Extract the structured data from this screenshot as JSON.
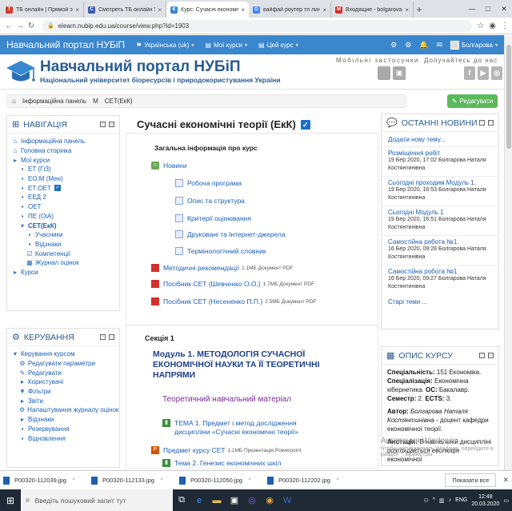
{
  "browser": {
    "tabs": [
      {
        "label": "ТБ онлайн | Прямой эфир",
        "color": "#d23b2b",
        "glyph": "Т"
      },
      {
        "label": "Смотреть ТБ онлайн Укра",
        "color": "#3b5bab",
        "glyph": "С"
      },
      {
        "label": "Курс: Сучасні економічні т",
        "color": "#3a87ce",
        "glyph": "К"
      },
      {
        "label": "вайфай роутер тп линк - Г",
        "color": "#4285f4",
        "glyph": "G"
      },
      {
        "label": "Входящие - bolgarova@gm",
        "color": "#d93025",
        "glyph": "M"
      }
    ],
    "url": "elearn.nubip.edu.ua/course/view.php?id=1903"
  },
  "moodle_nav": {
    "brand": "Навчальний портал НУБіП",
    "lang": "Українська (uk)",
    "my_courses": "Мої курси",
    "this_course": "Цей курс",
    "user": "Болгарова"
  },
  "banner": {
    "title": "Навчальний портал НУБіП",
    "subtitle": "Національний університет біоресурсів і природокористування України",
    "apps": "Мобільні застосунки",
    "join": "Долучайтесь до нас",
    "social": [
      "f",
      "▶",
      "◎"
    ]
  },
  "breadcrumb": [
    "Інформаційна панель",
    "М",
    "СЕТ(ЕкК)"
  ],
  "edit_button": "Редагувати",
  "navigation": {
    "title": "НАВІГАЦІЯ",
    "items": [
      {
        "label": "Інформаційна панель",
        "indent": 0,
        "icon": "⌂"
      },
      {
        "label": "Головна сторінка",
        "indent": 0,
        "icon": "⌂"
      },
      {
        "label": "Мої курси",
        "indent": 0,
        "icon": "▸"
      },
      {
        "label": "ЕТ (ГіЗ)",
        "indent": 1,
        "icon": "▪"
      },
      {
        "label": "ЕО:М (Мен)",
        "indent": 1,
        "icon": "▪"
      },
      {
        "label": "ЕТ:ОЕТ",
        "indent": 1,
        "icon": "▪",
        "check": true
      },
      {
        "label": "ЕЕД 2",
        "indent": 1,
        "icon": "▪"
      },
      {
        "label": "ОЕТ",
        "indent": 1,
        "icon": "▪"
      },
      {
        "label": "ПЕ (ОіА)",
        "indent": 1,
        "icon": "▪"
      },
      {
        "label": "СЕТ(ЕкК)",
        "indent": 1,
        "icon": "▾",
        "bold": true
      },
      {
        "label": "Учасники",
        "indent": 2,
        "icon": "▪"
      },
      {
        "label": "Відзнаки",
        "indent": 2,
        "icon": "▪"
      },
      {
        "label": "Компетенції",
        "indent": 2,
        "icon": "☑"
      },
      {
        "label": "Журнал оцінок",
        "indent": 2,
        "icon": "▦"
      },
      {
        "label": "Курси",
        "indent": 0,
        "icon": "▸"
      }
    ]
  },
  "management": {
    "title": "КЕРУВАННЯ",
    "items": [
      {
        "label": "Керування курсом",
        "indent": 0,
        "icon": "▾"
      },
      {
        "label": "Редагувати параметри",
        "indent": 1,
        "icon": "⚙"
      },
      {
        "label": "Редагувати",
        "indent": 1,
        "icon": "✎"
      },
      {
        "label": "Користувачі",
        "indent": 1,
        "icon": "▸"
      },
      {
        "label": "Фільтри",
        "indent": 1,
        "icon": "▼"
      },
      {
        "label": "Звіти",
        "indent": 1,
        "icon": "▸"
      },
      {
        "label": "Налаштування журналу оцінок",
        "indent": 1,
        "icon": "⚙"
      },
      {
        "label": "Відзнаки",
        "indent": 1,
        "icon": "▸"
      },
      {
        "label": "Резервування",
        "indent": 1,
        "icon": "▪"
      },
      {
        "label": "Відновлення",
        "indent": 1,
        "icon": "▪"
      }
    ]
  },
  "course": {
    "title": "Сучасні економічні теорії (ЕкК)",
    "general_heading": "Загальна інформація про курс",
    "general_activities": [
      {
        "label": "Новини",
        "type": "forum",
        "meta": ""
      },
      {
        "label": "Робоча програма",
        "type": "page",
        "meta": "",
        "indent": true
      },
      {
        "label": "Опис та структура",
        "type": "page",
        "meta": "",
        "indent": true
      },
      {
        "label": "Критерії оцінювання",
        "type": "page",
        "meta": "",
        "indent": true
      },
      {
        "label": "Друковані та Інтернет-джерела",
        "type": "page",
        "meta": "",
        "indent": true
      },
      {
        "label": "Термінологічний словник",
        "type": "page",
        "meta": "",
        "indent": true
      },
      {
        "label": "Методичні рекомендації",
        "type": "pdf",
        "meta": "1.1МБ Документ PDF"
      },
      {
        "label": "Посібник СЕТ (Шевченко О.О.)",
        "type": "pdf",
        "meta": "1.7МБ Документ PDF"
      },
      {
        "label": "Посібник СЕТ (Несененко П.П.)",
        "type": "pdf",
        "meta": "2.5МБ Документ PDF"
      }
    ],
    "section1": {
      "name": "Секція 1",
      "module_title": "Модуль 1.  МЕТОДОЛОГІЯ СУЧАСНОЇ ЕКОНОМІЧНОЇ НАУКИ ТА ЇЇ ТЕОРЕТИЧНІ НАПРЯМИ",
      "theory_label": "Теоретичний навчальний матеріал",
      "activities": [
        {
          "label": "ТЕМА 1. Предмет і метод дослідження дисципліни «Сучасні економічні теорії»",
          "type": "book",
          "meta": ""
        },
        {
          "label": "Предмет курсу СЕТ",
          "type": "ppt",
          "meta": "1.1МБ Презентація Powerpoint"
        },
        {
          "label": "Тема 2. Генезис економічних шкіл",
          "type": "book",
          "meta": ""
        }
      ]
    }
  },
  "news": {
    "title": "ОСТАННІ НОВИНИ",
    "add_link": "Додати нову тему...",
    "items": [
      {
        "title": "Розміщення робіт",
        "date": "19 Бер 2020, 17:02",
        "author": "Болгарова Наталя Костянтинівна"
      },
      {
        "title": "Сьогодні проходим Модуль 1.",
        "date": "19 Бер 2020, 16:53",
        "author": "Болгарова Наталя Костянтинівна"
      },
      {
        "title": "Сьогодні Модуль 1",
        "date": "19 Бер 2020, 16:51",
        "author": "Болгарова Наталя Костянтинівна"
      },
      {
        "title": "Самостійна робота №1.",
        "date": "16 Бер 2020, 09:28",
        "author": "Болгарова Наталя Костянтинівна"
      },
      {
        "title": "Самостійна робота №1",
        "date": "16 Бер 2020, 09:27",
        "author": "Болгарова Наталя Костянтинівна"
      }
    ],
    "older": "Старі теми ..."
  },
  "course_info": {
    "title": "ОПИС КУРСУ",
    "spec_label": "Спеціальність:",
    "spec_value": "151 Економіка.",
    "specialization_label": "Спеціалізація:",
    "specialization_value": "Економічна кібернетика.",
    "level_label": "ОС:",
    "level_value": "Бакалавр.",
    "semester_label": "Семестр:",
    "semester_value": "2.",
    "ects_label": "ECTS:",
    "ects_value": "3.",
    "author_label": "Автор:",
    "author_value": "Болгарова Наталя Костянтинівна",
    "author_rest": " - доцент кафедри економічної теорії.",
    "annot_label": "Анотація:",
    "annot_value": "В навчальній дисципліні розглядається еволюція економічної"
  },
  "watermark": {
    "line1": "Активация Windows",
    "line2": "Чтобы активировать Windows, перейдите в раздел \"Параметры\""
  },
  "downloads": {
    "files": [
      "P00320-112039.jpg",
      "P00320-112133.jpg",
      "P00320-112050.jpg",
      "P00320-112202.jpg"
    ],
    "show_all": "Показати все"
  },
  "taskbar": {
    "search_placeholder": "Введіть пошуковий запит тут",
    "lang": "ENG",
    "time": "12:48",
    "date": "20.03.2020"
  }
}
